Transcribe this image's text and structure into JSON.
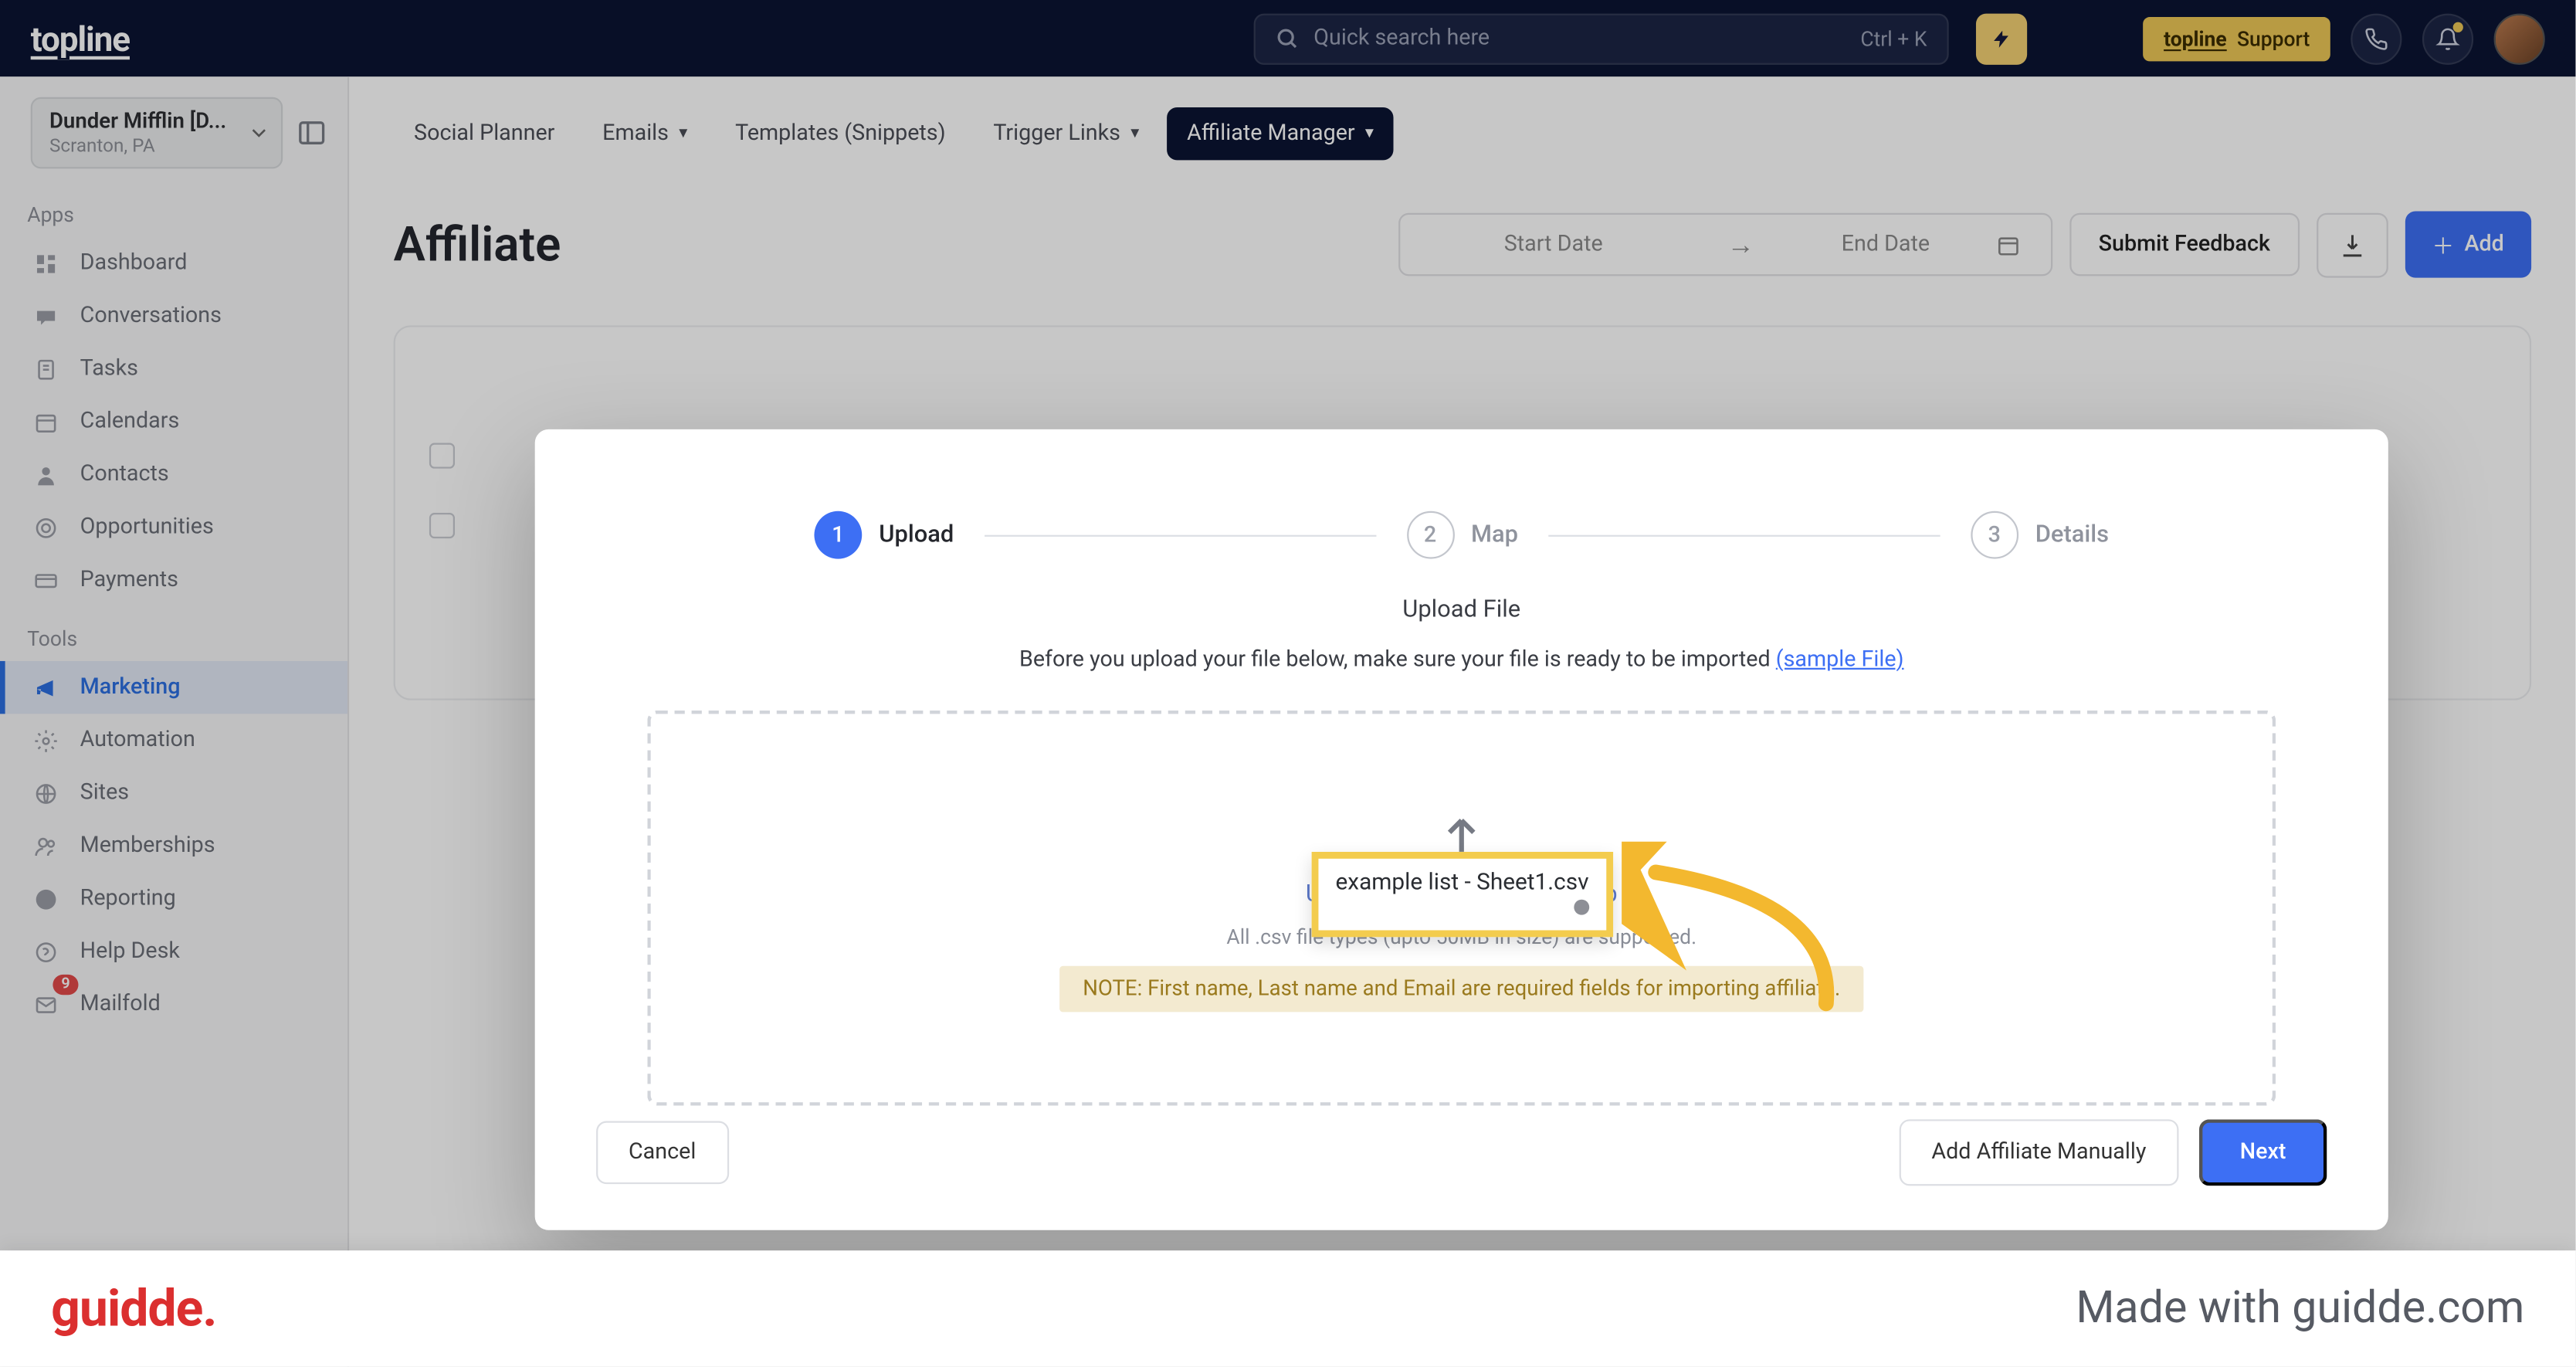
{
  "topbar": {
    "logo": "topline",
    "search_placeholder": "Quick search here",
    "search_shortcut": "Ctrl + K",
    "support_brand": "topline",
    "support_label": "Support"
  },
  "location": {
    "name": "Dunder Mifflin [D...",
    "sub": "Scranton, PA"
  },
  "sidebar": {
    "apps_heading": "Apps",
    "tools_heading": "Tools",
    "items_apps": [
      {
        "label": "Dashboard",
        "icon": "📊"
      },
      {
        "label": "Conversations",
        "icon": "💬"
      },
      {
        "label": "Tasks",
        "icon": "📄"
      },
      {
        "label": "Calendars",
        "icon": "📅"
      },
      {
        "label": "Contacts",
        "icon": "👤"
      },
      {
        "label": "Opportunities",
        "icon": "🎯"
      },
      {
        "label": "Payments",
        "icon": "💳"
      }
    ],
    "items_tools": [
      {
        "label": "Marketing",
        "icon": "📣"
      },
      {
        "label": "Automation",
        "icon": "⚙️"
      },
      {
        "label": "Sites",
        "icon": "🌐"
      },
      {
        "label": "Memberships",
        "icon": "👥"
      },
      {
        "label": "Reporting",
        "icon": "📈"
      },
      {
        "label": "Help Desk",
        "icon": "❔"
      },
      {
        "label": "Mailfold",
        "icon": "✉️"
      }
    ],
    "badge_count": "9"
  },
  "tabs": [
    {
      "label": "Social Planner"
    },
    {
      "label": "Emails"
    },
    {
      "label": "Templates (Snippets)"
    },
    {
      "label": "Trigger Links"
    },
    {
      "label": "Affiliate Manager"
    }
  ],
  "page": {
    "title": "Affiliate",
    "start_date": "Start Date",
    "end_date": "End Date",
    "feedback": "Submit Feedback",
    "add": "Add"
  },
  "modal": {
    "steps": [
      {
        "num": "1",
        "label": "Upload"
      },
      {
        "num": "2",
        "label": "Map"
      },
      {
        "num": "3",
        "label": "Details"
      }
    ],
    "subtitle": "Upload File",
    "desc_pre": "Before you upload your file below, make sure your file is ready to be imported ",
    "sample_link": "(sample File)",
    "drop_line1": "Upload a file or drag and drop",
    "drop_line2": "All .csv file types (upto 50MB in size) are supported.",
    "note": "NOTE: First name, Last name and Email are required fields for importing affiliate.",
    "cancel": "Cancel",
    "manual": "Add Affiliate Manually",
    "next": "Next"
  },
  "file_chip": {
    "name": "example list - Sheet1.csv"
  },
  "banner": {
    "logo": "guidde.",
    "made": "Made with guidde.com"
  }
}
